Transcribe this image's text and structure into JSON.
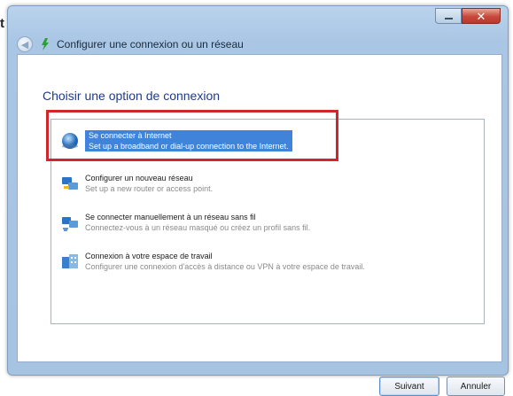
{
  "stray_text": "t",
  "window": {
    "title": "Configurer une connexion ou un réseau",
    "heading": "Choisir une option de connexion",
    "controls": {
      "close_glyph": "✕"
    }
  },
  "options": [
    {
      "label": "Se connecter à Internet",
      "desc": "Set up a broadband or dial-up connection to the Internet.",
      "icon": "globe-icon",
      "selected": true
    },
    {
      "label": "Configurer un nouveau réseau",
      "desc": "Set up a new router or access point.",
      "icon": "network-setup-icon",
      "selected": false
    },
    {
      "label": "Se connecter manuellement à un réseau sans fil",
      "desc": "Connectez-vous à un réseau masqué ou créez un profil sans fil.",
      "icon": "wireless-network-icon",
      "selected": false
    },
    {
      "label": "Connexion à votre espace de travail",
      "desc": "Configurer une connexion d'accès à distance ou VPN à votre espace de travail.",
      "icon": "workplace-icon",
      "selected": false
    }
  ],
  "buttons": {
    "next": "Suivant",
    "cancel": "Annuler"
  },
  "colors": {
    "accent_selection": "#3f84d8",
    "highlight_border": "#d1262b",
    "heading": "#1e3a8c"
  }
}
